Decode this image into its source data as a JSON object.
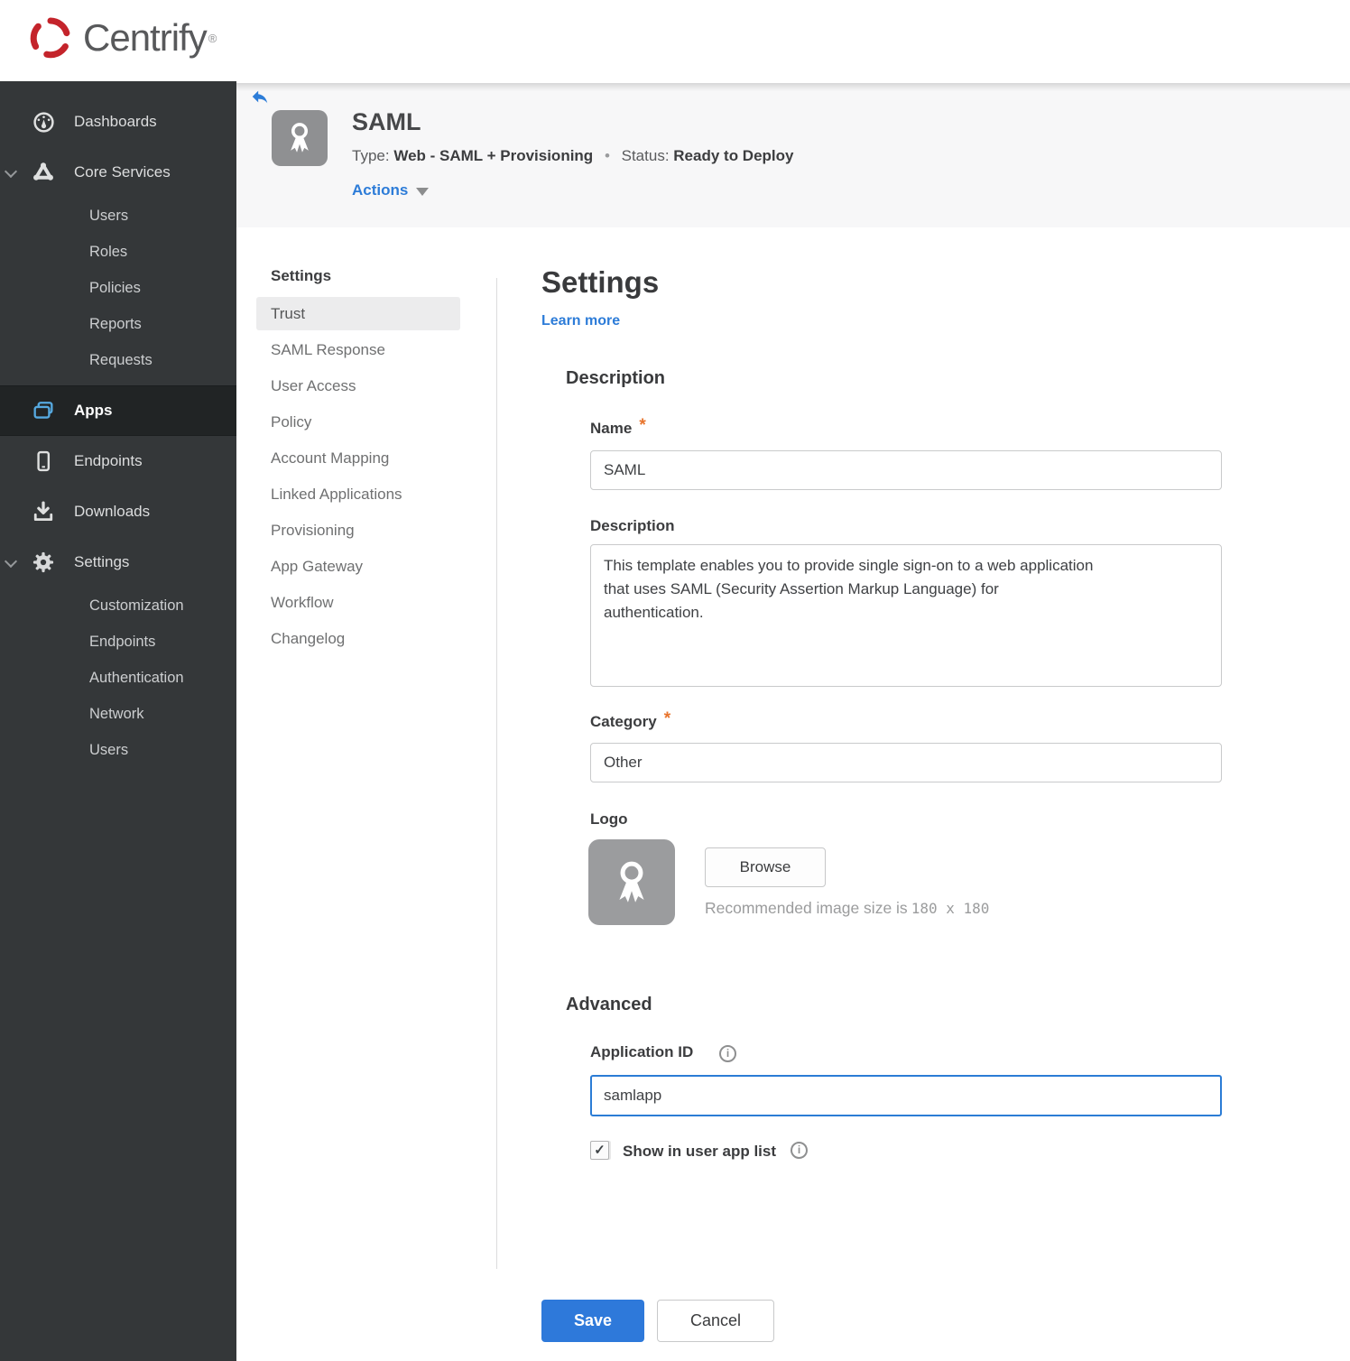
{
  "brand": {
    "name": "Centrify",
    "registered": "®"
  },
  "icons": {
    "info": "i",
    "check": "✓"
  },
  "required_marker": "*",
  "sidebar": {
    "active": "Apps",
    "items": [
      {
        "label": "Dashboards",
        "icon": "gauge"
      },
      {
        "label": "Core Services",
        "icon": "core-services",
        "expanded": true,
        "children": [
          "Users",
          "Roles",
          "Policies",
          "Reports",
          "Requests"
        ]
      },
      {
        "label": "Apps",
        "icon": "apps",
        "active": true
      },
      {
        "label": "Endpoints",
        "icon": "device"
      },
      {
        "label": "Downloads",
        "icon": "download"
      },
      {
        "label": "Settings",
        "icon": "gear",
        "expanded": true,
        "children": [
          "Customization",
          "Endpoints",
          "Authentication",
          "Network",
          "Users"
        ]
      }
    ]
  },
  "app_header": {
    "title": "SAML",
    "type_label": "Type:",
    "type_value": "Web - SAML + Provisioning",
    "separator": "•",
    "status_label": "Status:",
    "status_value": "Ready to Deploy",
    "actions_label": "Actions"
  },
  "subnav": {
    "header": "Settings",
    "active": "Trust",
    "items": [
      "Trust",
      "SAML Response",
      "User Access",
      "Policy",
      "Account Mapping",
      "Linked Applications",
      "Provisioning",
      "App Gateway",
      "Workflow",
      "Changelog"
    ]
  },
  "main": {
    "title": "Settings",
    "learn_more_label": "Learn more",
    "description": {
      "heading": "Description",
      "name_label": "Name",
      "name_value": "SAML",
      "description_label": "Description",
      "description_value": "This template enables you to provide single sign-on to a web application\nthat uses SAML (Security Assertion Markup Language) for\nauthentication.",
      "category_label": "Category",
      "category_value": "Other",
      "logo_label": "Logo",
      "browse_label": "Browse",
      "logo_hint_prefix": "Recommended image size is",
      "logo_hint_size": "180 x 180"
    },
    "advanced": {
      "heading": "Advanced",
      "application_id_label": "Application ID",
      "application_id_value": "samlapp",
      "show_in_user_app_list_label": "Show in user app list",
      "show_in_user_app_list_checked": true
    },
    "actions": {
      "save_label": "Save",
      "cancel_label": "Cancel"
    }
  },
  "colors": {
    "accent_blue": "#2d7cd8",
    "save_blue": "#2e79da",
    "status_red": "#a1242f",
    "required_orange": "#e8742c",
    "sidebar_bg": "#343739",
    "sidebar_active_bg": "#212425",
    "apps_icon_blue": "#56a9e0",
    "band_bg": "#f7f7f8"
  }
}
